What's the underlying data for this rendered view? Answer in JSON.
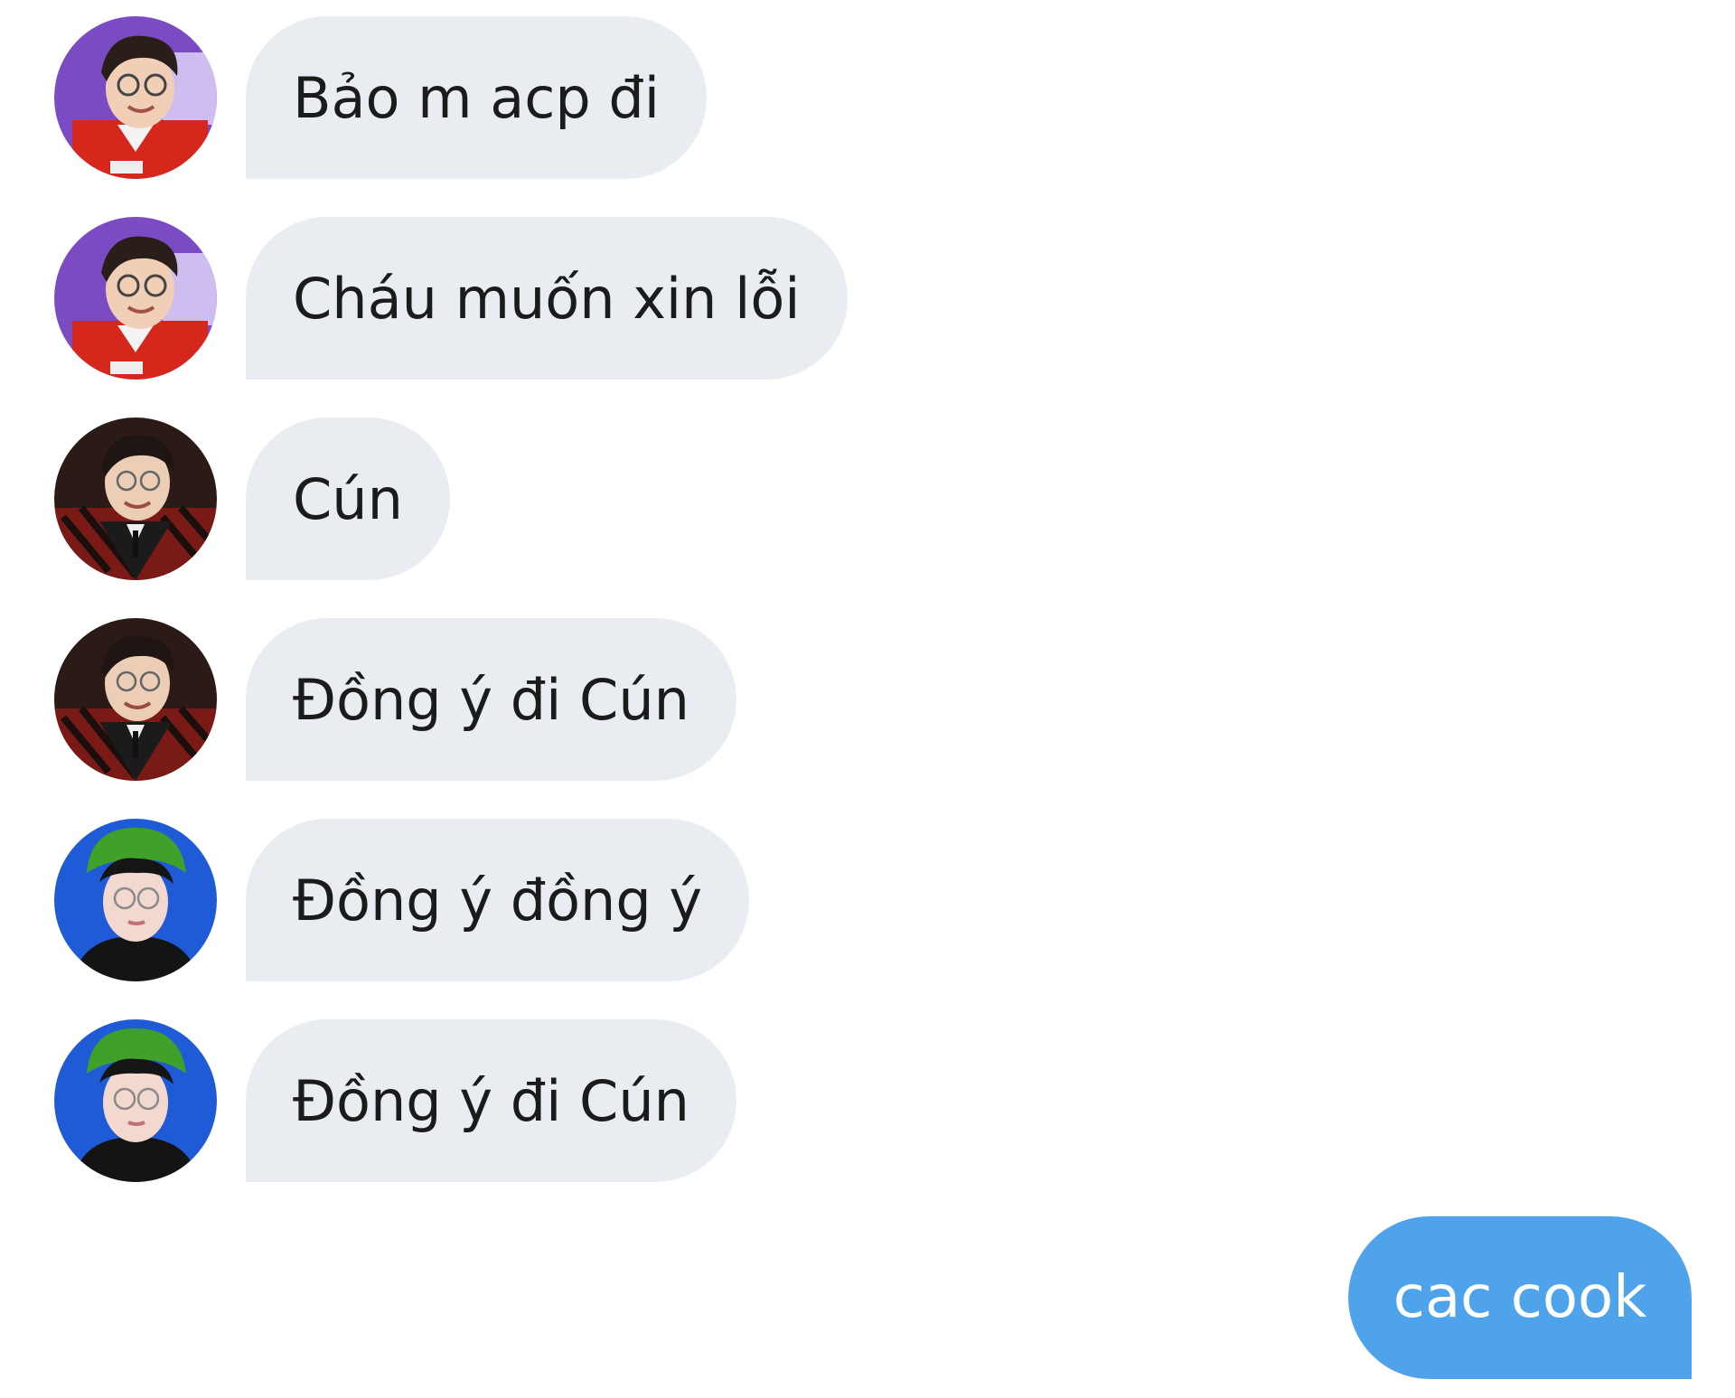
{
  "messages": [
    {
      "text": "Bảo m acp đi",
      "avatar": "avatar-red-jacket"
    },
    {
      "text": "Cháu muốn xin lỗi",
      "avatar": "avatar-red-jacket"
    },
    {
      "text": "Cún",
      "avatar": "avatar-dark-suit"
    },
    {
      "text": "Đồng ý đi Cún",
      "avatar": "avatar-dark-suit"
    },
    {
      "text": "Đồng ý đồng ý",
      "avatar": "avatar-blue-background"
    },
    {
      "text": "Đồng ý đi Cún",
      "avatar": "avatar-blue-background"
    }
  ],
  "outgoing": {
    "text": "cac cook"
  },
  "colors": {
    "incoming_bubble": "#e9ecf0",
    "outgoing_bubble": "#4fa3ea",
    "incoming_text": "#1b1b1b",
    "outgoing_text": "#ffffff"
  }
}
